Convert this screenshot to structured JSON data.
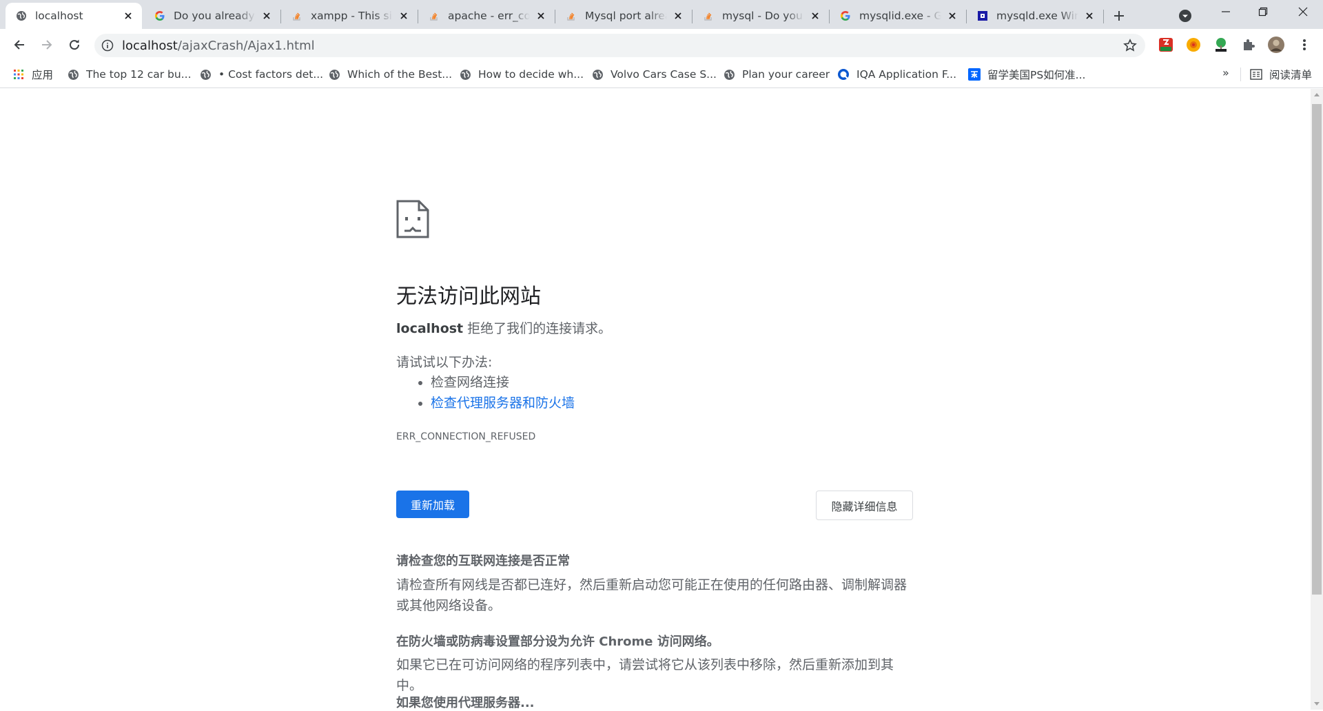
{
  "tabs": [
    {
      "title": "localhost",
      "icon": "globe-icon",
      "active": true
    },
    {
      "title": "Do you already know",
      "icon": "google-icon"
    },
    {
      "title": "xampp - This site",
      "icon": "stackoverflow-icon"
    },
    {
      "title": "apache - err_connection",
      "icon": "stackoverflow-icon"
    },
    {
      "title": "Mysql port already",
      "icon": "stackoverflow-icon"
    },
    {
      "title": "mysql - Do you",
      "icon": "stackoverflow-icon"
    },
    {
      "title": "mysqlid.exe - Google",
      "icon": "google-icon"
    },
    {
      "title": "mysqld.exe Windows",
      "icon": "site-icon"
    }
  ],
  "address": {
    "host": "localhost",
    "path": "/ajaxCrash/Ajax1.html"
  },
  "bookmarks": [
    {
      "label": "应用",
      "icon": "apps-grid-icon"
    },
    {
      "label": "The top 12 car bu...",
      "icon": "globe-icon"
    },
    {
      "label": "• Cost factors det...",
      "icon": "globe-icon"
    },
    {
      "label": "Which of the Best...",
      "icon": "globe-icon"
    },
    {
      "label": "How to decide wh...",
      "icon": "globe-icon"
    },
    {
      "label": "Volvo Cars Case S...",
      "icon": "globe-icon"
    },
    {
      "label": "Plan your career",
      "icon": "globe-icon"
    },
    {
      "label": "IQA Application F...",
      "icon": "iqa-icon"
    },
    {
      "label": "留学美国PS如何准...",
      "icon": "zhihu-icon"
    }
  ],
  "bookmarks_more": "»",
  "reading_list": "阅读清单",
  "error": {
    "title": "无法访问此网站",
    "host": "localhost",
    "subtitle_rest": " 拒绝了我们的连接请求。",
    "suggest_head": "请试试以下办法:",
    "suggestions": [
      "检查网络连接",
      "检查代理服务器和防火墙"
    ],
    "code": "ERR_CONNECTION_REFUSED",
    "reload_label": "重新加载",
    "details_label": "隐藏详细信息",
    "details": [
      {
        "heading": "请检查您的互联网连接是否正常",
        "body": "请检查所有网线是否都已连好，然后重新启动您可能正在使用的任何路由器、调制解调器或其他网络设备。"
      },
      {
        "heading": "在防火墙或防病毒设置部分设为允许 Chrome 访问网络。",
        "body": "如果它已在可访问网络的程序列表中，请尝试将它从该列表中移除，然后重新添加到其中。"
      },
      {
        "heading": "如果您使用代理服务器...",
        "body": ""
      }
    ]
  },
  "colors": {
    "accent": "#1a73e8",
    "tabstrip": "#dee1e6",
    "text_secondary": "#5f6368"
  }
}
